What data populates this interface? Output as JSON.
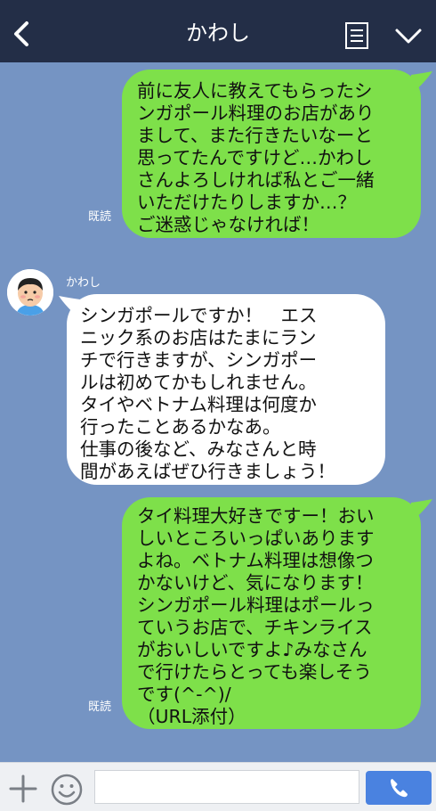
{
  "header": {
    "title": "かわし"
  },
  "messages": [
    {
      "side": "right",
      "read": "既読",
      "text": "前に友人に教えてもらったシ\nンガポール料理のお店があり\nまして、また行きたいなーと\n思ってたんですけど…かわし\nさんよろしければ私とご一緒\nいただけたりしますか…？\nご迷惑じゃなければ！"
    },
    {
      "side": "left",
      "sender": "かわし",
      "text": "シンガポールですか！　エス\nニック系のお店はたまにラン\nチで行きますが、シンガポー\nルは初めてかもしれません。\nタイやベトナム料理は何度か\n行ったことあるかなあ。\n仕事の後など、みなさんと時\n間があえばぜひ行きましょう！"
    },
    {
      "side": "right",
      "read": "既読",
      "text": "タイ料理大好きですー！おい\nしいところいっぱいあります\nよね。ベトナム料理は想像つ\nかないけど、気になります！\nシンガポール料理はポールっ\nていうお店で、チキンライス\nがおいしいですよ♪みなさん\nで行けたらとっても楽しそう\nです(^-^)/\n（URL添付）"
    }
  ],
  "input": {
    "placeholder": ""
  },
  "colors": {
    "header": "#232e47",
    "background": "#7594c3",
    "my_bubble": "#7ee04a",
    "their_bubble": "#ffffff",
    "send": "#4a82e0"
  },
  "icons": [
    "back-icon",
    "note-icon",
    "chevron-down-icon",
    "plus-icon",
    "smile-icon",
    "phone-icon",
    "avatar"
  ]
}
